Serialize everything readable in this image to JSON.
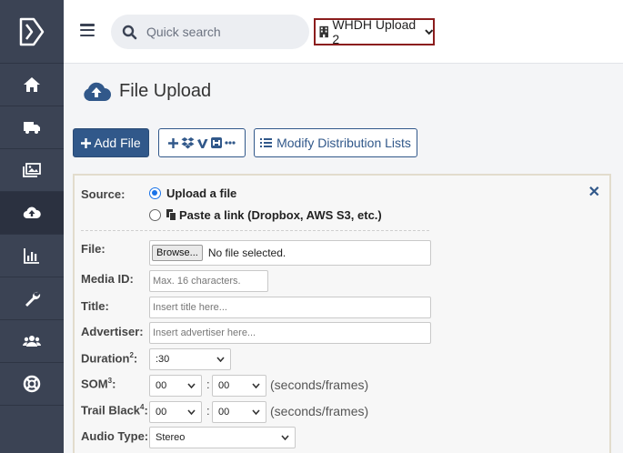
{
  "sidebar": {
    "logo_icon": "app-logo",
    "items": [
      {
        "icon": "home-icon",
        "active": false
      },
      {
        "icon": "truck-icon",
        "active": false
      },
      {
        "icon": "images-icon",
        "active": false
      },
      {
        "icon": "cloud-upload-icon",
        "active": true
      },
      {
        "icon": "chart-bar-icon",
        "active": false
      },
      {
        "icon": "wrench-icon",
        "active": false
      },
      {
        "icon": "users-icon",
        "active": false
      },
      {
        "icon": "life-ring-icon",
        "active": false
      }
    ]
  },
  "topbar": {
    "search_placeholder": "Quick search",
    "account": "WHDH Upload 2"
  },
  "page": {
    "title": "File Upload"
  },
  "toolbar": {
    "add_file": "Add File",
    "modify_lists": "Modify Distribution Lists"
  },
  "form": {
    "source_label": "Source:",
    "option_upload": "Upload a file",
    "option_paste": "Paste a link (Dropbox, AWS S3, etc.)",
    "file_label": "File:",
    "browse_label": "Browse...",
    "file_status": "No file selected.",
    "media_id_label": "Media ID:",
    "media_id_placeholder": "Max. 16 characters.",
    "title_label": "Title:",
    "title_placeholder": "Insert title here...",
    "advertiser_label": "Advertiser:",
    "advertiser_placeholder": "Insert advertiser here...",
    "duration_label": "Duration",
    "duration_sup": "2",
    "duration_value": ":30",
    "som_label": "SOM",
    "som_sup": "3",
    "som_seconds": "00",
    "som_frames": "00",
    "trail_label": "Trail Black",
    "trail_sup": "4",
    "trail_seconds": "00",
    "trail_frames": "00",
    "units_hint": "(seconds/frames)",
    "audio_label": "Audio Type:",
    "audio_value": "Stereo"
  },
  "colors": {
    "sidebar": "#3b4354",
    "primary": "#31588a",
    "account_border": "#8b1d1d"
  }
}
